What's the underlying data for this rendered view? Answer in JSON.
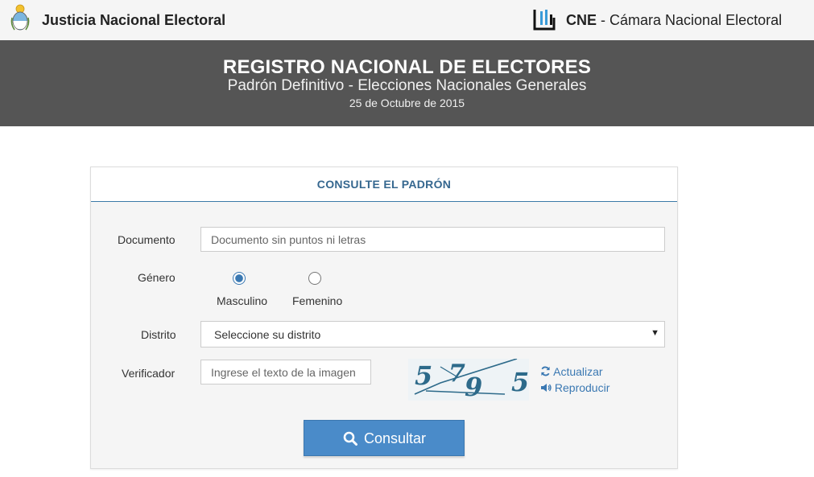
{
  "header": {
    "brand": "Justicia Nacional Electoral",
    "cne_abbr": "CNE",
    "cne_name": " - Cámara Nacional Electoral"
  },
  "banner": {
    "title": "REGISTRO NACIONAL DE ELECTORES",
    "subtitle": "Padrón Definitivo - Elecciones Nacionales Generales",
    "date": "25 de Octubre de 2015"
  },
  "form": {
    "title": "CONSULTE EL PADRÓN",
    "documento": {
      "label": "Documento",
      "placeholder": "Documento sin puntos ni letras",
      "value": ""
    },
    "genero": {
      "label": "Género",
      "options": [
        {
          "label": "Masculino",
          "selected": true
        },
        {
          "label": "Femenino",
          "selected": false
        }
      ]
    },
    "distrito": {
      "label": "Distrito",
      "selected": "Seleccione su distrito"
    },
    "verificador": {
      "label": "Verificador",
      "placeholder": "Ingrese el texto de la imagen",
      "captcha_text": "5795",
      "refresh": "Actualizar",
      "play": "Reproducir"
    },
    "submit": "Consultar"
  },
  "colors": {
    "accent": "#4a8bc9",
    "banner": "#555555",
    "panel_title": "#35678f",
    "link": "#3a78b2"
  }
}
